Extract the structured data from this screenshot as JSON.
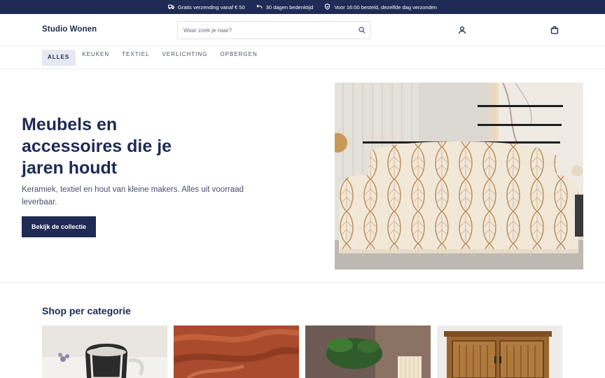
{
  "announcement": {
    "perks": [
      {
        "icon": "truck-icon",
        "text": "Gratis verzending vanaf € 50"
      },
      {
        "icon": "return-arrow-icon",
        "text": "30 dagen bedenktijd"
      },
      {
        "icon": "shield-icon",
        "text": "Voor 16:00 besteld, dezelfde dag verzonden"
      }
    ]
  },
  "header": {
    "logo": "Studio Wonen",
    "search": {
      "placeholder": "Waar zoek je naar?",
      "value": "",
      "icon": "search-icon"
    },
    "account_icon": "user-icon",
    "cart_icon": "shopping-bag-icon"
  },
  "nav": {
    "tabs": [
      {
        "label": "ALLES",
        "active": true
      },
      {
        "label": "KEUKEN",
        "active": false
      },
      {
        "label": "TEXTIEL",
        "active": false
      },
      {
        "label": "VERLICHTING",
        "active": false
      },
      {
        "label": "OPBERGEN",
        "active": false
      }
    ]
  },
  "hero": {
    "title": "Meubels en accessoires die je jaren houdt",
    "subtitle": "Keramiek, textiel en hout van kleine makers. Alles uit voorraad leverbaar.",
    "cta": "Bekijk de collectie"
  },
  "categories": {
    "title": "Shop per categorie"
  },
  "colors": {
    "navy": "#1f2a55",
    "text": "#1e2a4a",
    "muted": "#4a5068",
    "active_tab_bg": "#e6e9f2"
  }
}
